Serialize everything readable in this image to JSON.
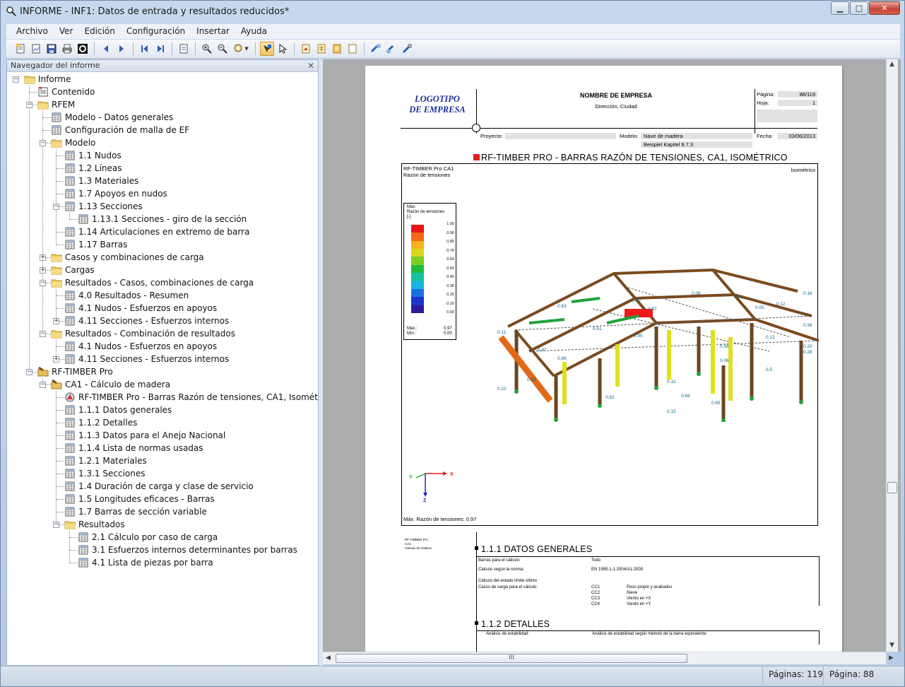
{
  "window": {
    "title": "INFORME - INF1: Datos de entrada y resultados reducidos*",
    "controls": {
      "minimize": "▁",
      "maximize": "□",
      "close": "✕"
    }
  },
  "menu": [
    "Archivo",
    "Ver",
    "Edición",
    "Configuración",
    "Insertar",
    "Ayuda"
  ],
  "navigator": {
    "title": "Navegador del informe",
    "close": "✕",
    "items": [
      {
        "label": "Informe",
        "level": 0,
        "icon": "folder",
        "exp": "-"
      },
      {
        "label": "Contenido",
        "level": 1,
        "icon": "contents",
        "exp": ""
      },
      {
        "label": "RFEM",
        "level": 1,
        "icon": "folder",
        "exp": "-"
      },
      {
        "label": "Modelo - Datos generales",
        "level": 2,
        "icon": "table",
        "exp": ""
      },
      {
        "label": "Configuración de malla de EF",
        "level": 2,
        "icon": "table",
        "exp": ""
      },
      {
        "label": "Modelo",
        "level": 2,
        "icon": "folder",
        "exp": "-"
      },
      {
        "label": "1.1 Nudos",
        "level": 3,
        "icon": "table",
        "exp": ""
      },
      {
        "label": "1.2 Líneas",
        "level": 3,
        "icon": "table",
        "exp": ""
      },
      {
        "label": "1.3 Materiales",
        "level": 3,
        "icon": "table",
        "exp": ""
      },
      {
        "label": "1.7 Apoyos en nudos",
        "level": 3,
        "icon": "table",
        "exp": ""
      },
      {
        "label": "1.13 Secciones",
        "level": 3,
        "icon": "table",
        "exp": "-"
      },
      {
        "label": "1.13.1 Secciones - giro de la sección",
        "level": 4,
        "icon": "table",
        "exp": ""
      },
      {
        "label": "1.14 Articulaciones en extremo de barra",
        "level": 3,
        "icon": "table",
        "exp": ""
      },
      {
        "label": "1.17 Barras",
        "level": 3,
        "icon": "table",
        "exp": ""
      },
      {
        "label": "Casos y combinaciones de carga",
        "level": 2,
        "icon": "folder",
        "exp": "+"
      },
      {
        "label": "Cargas",
        "level": 2,
        "icon": "folder",
        "exp": "+"
      },
      {
        "label": "Resultados - Casos, combinaciones de carga",
        "level": 2,
        "icon": "folder",
        "exp": "-"
      },
      {
        "label": "4.0 Resultados - Resumen",
        "level": 3,
        "icon": "table",
        "exp": ""
      },
      {
        "label": "4.1 Nudos - Esfuerzos en apoyos",
        "level": 3,
        "icon": "table",
        "exp": ""
      },
      {
        "label": "4.11 Secciones - Esfuerzos internos",
        "level": 3,
        "icon": "table",
        "exp": "+"
      },
      {
        "label": "Resultados - Combinación de resultados",
        "level": 2,
        "icon": "folder",
        "exp": "-"
      },
      {
        "label": "4.1 Nudos - Esfuerzos en apoyos",
        "level": 3,
        "icon": "table",
        "exp": ""
      },
      {
        "label": "4.11 Secciones - Esfuerzos internos",
        "level": 3,
        "icon": "table",
        "exp": "+"
      },
      {
        "label": "RF-TIMBER Pro",
        "level": 1,
        "icon": "module",
        "exp": "-"
      },
      {
        "label": "CA1 - Cálculo de madera",
        "level": 2,
        "icon": "module",
        "exp": "-"
      },
      {
        "label": "RF-TIMBER Pro - Barras Razón de tensiones, CA1, Isométrico",
        "level": 3,
        "icon": "graphic",
        "exp": ""
      },
      {
        "label": "1.1.1 Datos generales",
        "level": 3,
        "icon": "table",
        "exp": ""
      },
      {
        "label": "1.1.2 Detalles",
        "level": 3,
        "icon": "table",
        "exp": ""
      },
      {
        "label": "1.1.3 Datos para el Anejo Nacional",
        "level": 3,
        "icon": "table",
        "exp": ""
      },
      {
        "label": "1.1.4 Lista de normas usadas",
        "level": 3,
        "icon": "table",
        "exp": ""
      },
      {
        "label": "1.2.1 Materiales",
        "level": 3,
        "icon": "table",
        "exp": ""
      },
      {
        "label": "1.3.1 Secciones",
        "level": 3,
        "icon": "table",
        "exp": ""
      },
      {
        "label": "1.4 Duración de carga y clase de servicio",
        "level": 3,
        "icon": "table",
        "exp": ""
      },
      {
        "label": "1.5 Longitudes eficaces - Barras",
        "level": 3,
        "icon": "table",
        "exp": ""
      },
      {
        "label": "1.7 Barras de sección variable",
        "level": 3,
        "icon": "table",
        "exp": ""
      },
      {
        "label": "Resultados",
        "level": 3,
        "icon": "folder",
        "exp": "-"
      },
      {
        "label": "2.1 Cálculo por caso de carga",
        "level": 4,
        "icon": "table",
        "exp": ""
      },
      {
        "label": "3.1 Esfuerzos internos determinantes por barras",
        "level": 4,
        "icon": "table",
        "exp": ""
      },
      {
        "label": "4.1 Lista de piezas por barra",
        "level": 4,
        "icon": "table",
        "exp": ""
      }
    ]
  },
  "page": {
    "logo_line1": "LOGOTIPO",
    "logo_line2": "DE EMPRESA",
    "company": "NOMBRE DE EMPRESA",
    "address": "Dirección, Ciudad",
    "pagina_label": "Página:",
    "pagina_value": "88/119",
    "hoja_label": "Hoja:",
    "hoja_value": "1",
    "proyecto_label": "Proyecto:",
    "modelo_label": "Modelo:",
    "modelo_value": "Nave de madera",
    "modelo_sub": "Beispiel Kapitel 9.7.3",
    "fecha_label": "Fecha:",
    "fecha_value": "03/06/2013",
    "graphic_title": "RF-TIMBER PRO - BARRAS RAZÓN DE TENSIONES, CA1, ISOMÉTRICO",
    "graphic_hdr1": "RF-TIMBER Pro CA1",
    "graphic_hdr2": "Razón de tensiones",
    "graphic_view": "Isométrico",
    "legend_title1": "Máx.",
    "legend_title2": "Razón de tensiones",
    "legend_unit": "[-]",
    "legend_values": [
      "1.00",
      "0.90",
      "0.80",
      "0.70",
      "0.60",
      "0.50",
      "0.40",
      "0.30",
      "0.20",
      "0.10",
      "0.00"
    ],
    "legend_colors": [
      "#e8141a",
      "#f06a18",
      "#f5b21c",
      "#d9d51e",
      "#7ccd27",
      "#1fba3a",
      "#16c3a0",
      "#17b3e6",
      "#1a6fe1",
      "#1f34c8",
      "#2a1a9b"
    ],
    "legend_max_label": "Máx.:",
    "legend_max": "0.97",
    "legend_min_label": "Mín.:",
    "legend_min": "0.00",
    "max_note": "Máx. Razón de tensiones: 0.97",
    "axis_x": "X",
    "axis_y": "Y",
    "axis_z": "Z",
    "side_note1": "RF-TIMBER Pro",
    "side_note2": "CA1",
    "side_note3": "Cálculo de madera",
    "sec1_title": "1.1.1 DATOS GENERALES",
    "sec1_rows": [
      {
        "k": "Barras para el cálculo:",
        "v": "Todo",
        "d": ""
      },
      {
        "k": "Cálculo según la norma:",
        "v": "EN 1995-1-1:2004/A1:2008",
        "d": ""
      },
      {
        "k": "Cálculo del estado límite último",
        "v": "",
        "d": ""
      },
      {
        "k": "Casos de carga para el cálculo:",
        "v": "CC1",
        "d": "Peso propio y acabados"
      },
      {
        "k": "",
        "v": "CC2",
        "d": "Nieve"
      },
      {
        "k": "",
        "v": "CC3",
        "d": "Viento en +X"
      },
      {
        "k": "",
        "v": "CC4",
        "d": "Viento en +Y"
      }
    ],
    "sec2_title": "1.1.2 DETALLES",
    "sec2_k": "Análisis de estabilidad:",
    "sec2_v": "Análisis de estabilidad según método de la barra equivalente",
    "labels": [
      "0.16",
      "0.36",
      "0.20",
      "0.28",
      "0.5",
      "0.12",
      "0.06",
      "0.06",
      "0.32",
      "0.15",
      "0.69",
      "0.65",
      "0.11",
      "0.22",
      "0.62",
      "0.87",
      "0.66",
      "0.95",
      "0.97",
      "0.63",
      "0.70",
      "0.51",
      "0.31",
      "0.08",
      "0.12",
      "0.05",
      "0.69"
    ]
  },
  "status": {
    "paginas": "Páginas: 119",
    "pagina": "Página: 88"
  },
  "hscroll_grip": "III"
}
